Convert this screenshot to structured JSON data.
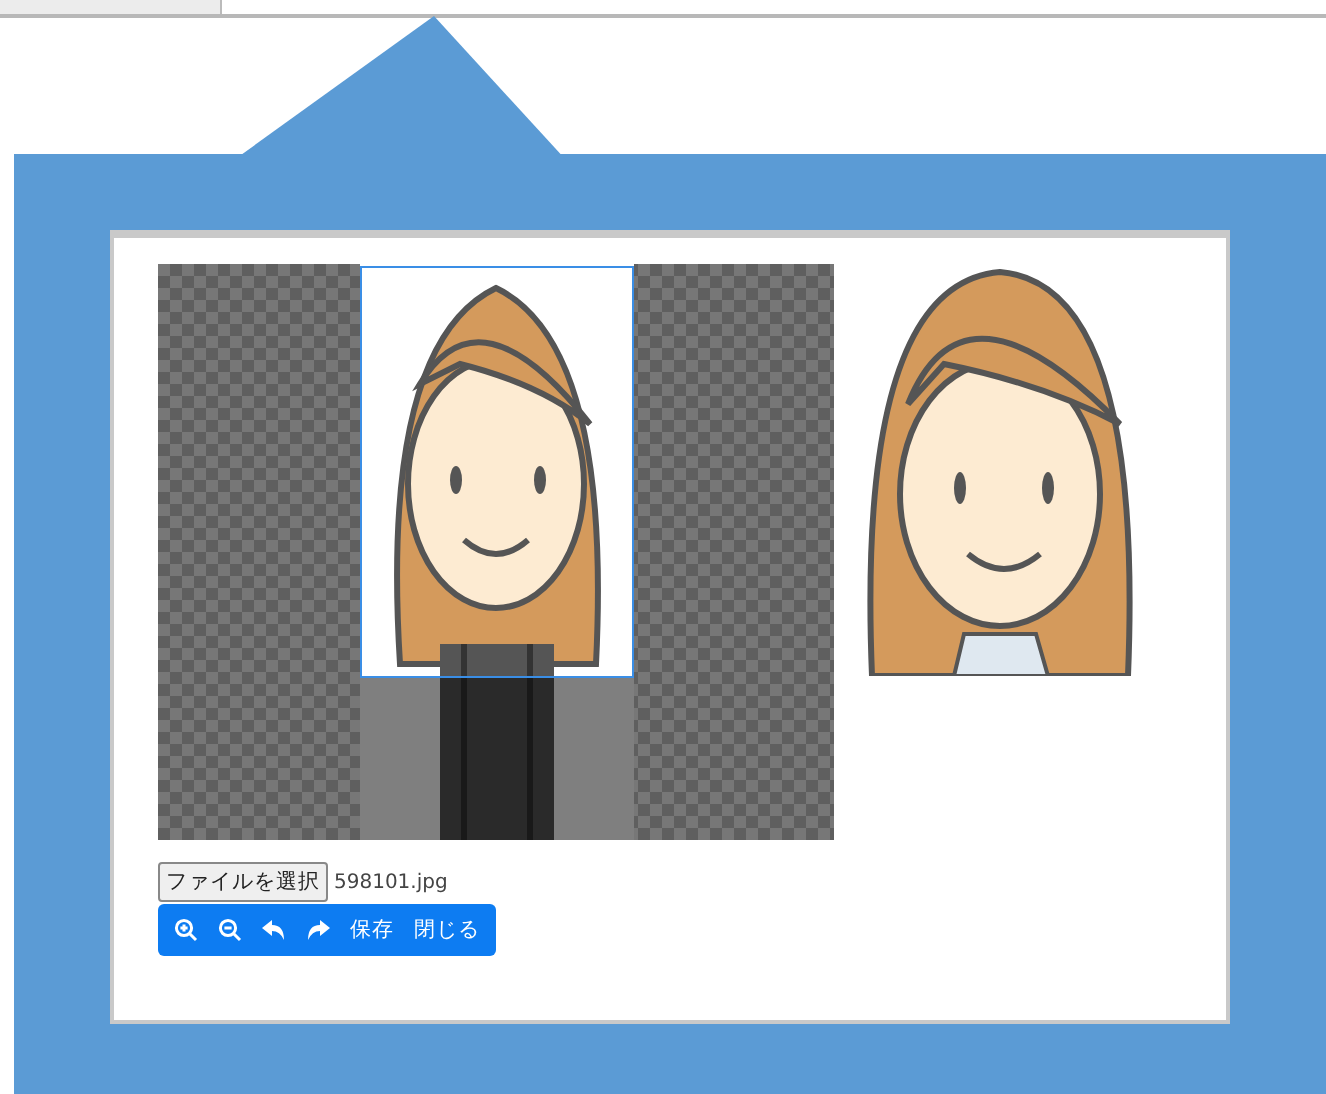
{
  "file_input": {
    "button": "ファイルを選択",
    "filename": "598101.jpg"
  },
  "toolbar": {
    "buttons": [
      {
        "label": "保存"
      },
      {
        "label": "閉じる"
      }
    ]
  }
}
